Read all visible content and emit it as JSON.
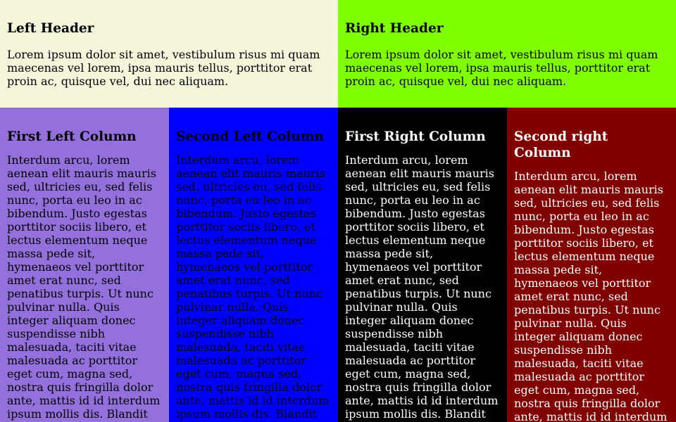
{
  "header": {
    "left": {
      "title": "Left Header",
      "text": "Lorem ipsum dolor sit amet, vestibulum risus mi quam maecenas vel lorem, ipsa mauris tellus, porttitor erat proin ac, quisque vel, dui nec aliquam.",
      "background": "#F5F5DC",
      "color": "#000000"
    },
    "right": {
      "title": "Right Header",
      "text": "Lorem ipsum dolor sit amet, vestibulum risus mi quam maecenas vel lorem, ipsa mauris tellus, porttitor erat proin ac, quisque vel, dui nec aliquam.",
      "background": "#7FFF00",
      "color": "#000000"
    }
  },
  "columns": [
    {
      "title": "First Left Column",
      "text": "Interdum arcu, lorem aenean elit mauris mauris sed, ultricies eu, sed felis nunc, porta eu leo in ac bibendum. Justo egestas porttitor sociis libero, et lectus elementum neque massa pede sit, hymenaeos vel porttitor amet erat nunc, sed penatibus turpis. Ut nunc pulvinar nulla. Quis integer aliquam donec suspendisse nibh malesuada, taciti vitae malesuada ac porttitor eget cum, magna sed, nostra quis fringilla dolor ante, mattis id id interdum ipsum mollis dis. Blandit",
      "background": "#9370DB",
      "color": "#000000"
    },
    {
      "title": "Second Left Column",
      "text": "Interdum arcu, lorem aenean elit mauris mauris sed, ultricies eu, sed felis nunc, porta eu leo in ac bibendum. Justo egestas porttitor sociis libero, et lectus elementum neque massa pede sit, hymenaeos vel porttitor amet erat nunc, sed penatibus turpis. Ut nunc pulvinar nulla. Quis integer aliquam donec suspendisse nibh malesuada, taciti vitae malesuada ac porttitor eget cum, magna sed, nostra quis fringilla dolor ante, mattis id id interdum ipsum mollis dis. Blandit",
      "background": "#0000FF",
      "color": "#000000"
    },
    {
      "title": "First Right Column",
      "text": "Interdum arcu, lorem aenean elit mauris mauris sed, ultricies eu, sed felis nunc, porta eu leo in ac bibendum. Justo egestas porttitor sociis libero, et lectus elementum neque massa pede sit, hymenaeos vel porttitor amet erat nunc, sed penatibus turpis. Ut nunc pulvinar nulla. Quis integer aliquam donec suspendisse nibh malesuada, taciti vitae malesuada ac porttitor eget cum, magna sed, nostra quis fringilla dolor ante, mattis id id interdum ipsum mollis dis. Blandit",
      "background": "#000000",
      "color": "#FFFFFF"
    },
    {
      "title": "Second right Column",
      "text": "Interdum arcu, lorem aenean elit mauris mauris sed, ultricies eu, sed felis nunc, porta eu leo in ac bibendum. Justo egestas porttitor sociis libero, et lectus elementum neque massa pede sit, hymenaeos vel porttitor amet erat nunc, sed penatibus turpis. Ut nunc pulvinar nulla. Quis integer aliquam donec suspendisse nibh malesuada, taciti vitae malesuada ac porttitor eget cum, magna sed, nostra quis fringilla dolor ante, mattis id id interdum",
      "background": "#800000",
      "color": "#FFFFFF"
    }
  ]
}
